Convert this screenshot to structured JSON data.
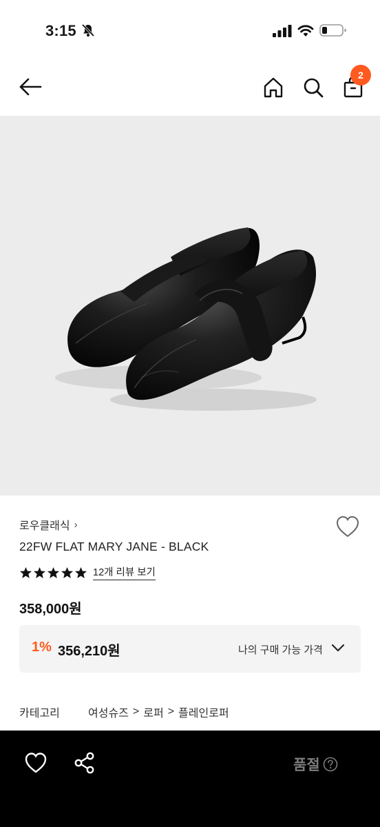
{
  "status_bar": {
    "time": "3:15"
  },
  "nav": {
    "cart_count": "2"
  },
  "product": {
    "brand": "로우클래식",
    "name": "22FW FLAT MARY JANE - BLACK",
    "rating": 5,
    "review_link": "12개 리뷰 보기",
    "price": "358,000원",
    "discount_rate": "1%",
    "discount_price": "356,210원",
    "my_price_label": "나의 구매 가능 가격"
  },
  "category": {
    "label": "카테고리",
    "path": [
      "여성슈즈",
      "로퍼",
      "플레인로퍼"
    ]
  },
  "bottom_bar": {
    "status_label": "품절"
  },
  "colors": {
    "accent": "#ff5a1f",
    "bottom_bar": "#000000",
    "hero_bg": "#ececec"
  },
  "icons": [
    "bell-off-icon",
    "signal-icon",
    "wifi-icon",
    "battery-icon",
    "back-arrow-icon",
    "home-icon",
    "search-icon",
    "shopping-bag-icon",
    "heart-icon",
    "star-icon",
    "chevron-down-icon",
    "share-icon",
    "help-icon"
  ]
}
